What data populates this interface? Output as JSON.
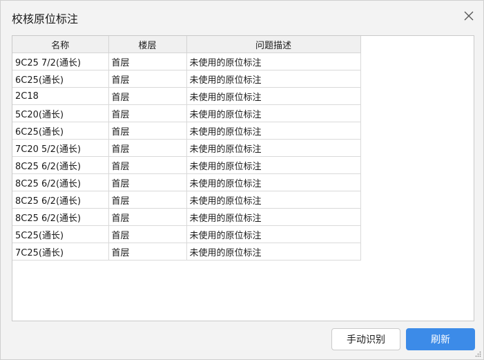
{
  "dialog": {
    "title": "校核原位标注"
  },
  "table": {
    "columns": [
      "名称",
      "楼层",
      "问题描述"
    ],
    "rows": [
      {
        "name": "9C25 7/2(通长)",
        "floor": "首层",
        "desc": "未使用的原位标注"
      },
      {
        "name": "6C25(通长)",
        "floor": "首层",
        "desc": "未使用的原位标注"
      },
      {
        "name": "2C18",
        "floor": "首层",
        "desc": "未使用的原位标注"
      },
      {
        "name": "5C20(通长)",
        "floor": "首层",
        "desc": "未使用的原位标注"
      },
      {
        "name": "6C25(通长)",
        "floor": "首层",
        "desc": "未使用的原位标注"
      },
      {
        "name": "7C20 5/2(通长)",
        "floor": "首层",
        "desc": "未使用的原位标注"
      },
      {
        "name": "8C25 6/2(通长)",
        "floor": "首层",
        "desc": "未使用的原位标注"
      },
      {
        "name": "8C25 6/2(通长)",
        "floor": "首层",
        "desc": "未使用的原位标注"
      },
      {
        "name": "8C25 6/2(通长)",
        "floor": "首层",
        "desc": "未使用的原位标注"
      },
      {
        "name": "8C25 6/2(通长)",
        "floor": "首层",
        "desc": "未使用的原位标注"
      },
      {
        "name": "5C25(通长)",
        "floor": "首层",
        "desc": "未使用的原位标注"
      },
      {
        "name": "7C25(通长)",
        "floor": "首层",
        "desc": "未使用的原位标注"
      }
    ]
  },
  "buttons": {
    "manual_label": "手动识别",
    "refresh_label": "刷新"
  },
  "icons": {
    "close": "close-icon",
    "resize": "resize-grip-icon"
  },
  "colors": {
    "accent": "#3c8be8",
    "header_bg": "#f0f0f0",
    "dialog_bg": "#f3f3f3"
  }
}
